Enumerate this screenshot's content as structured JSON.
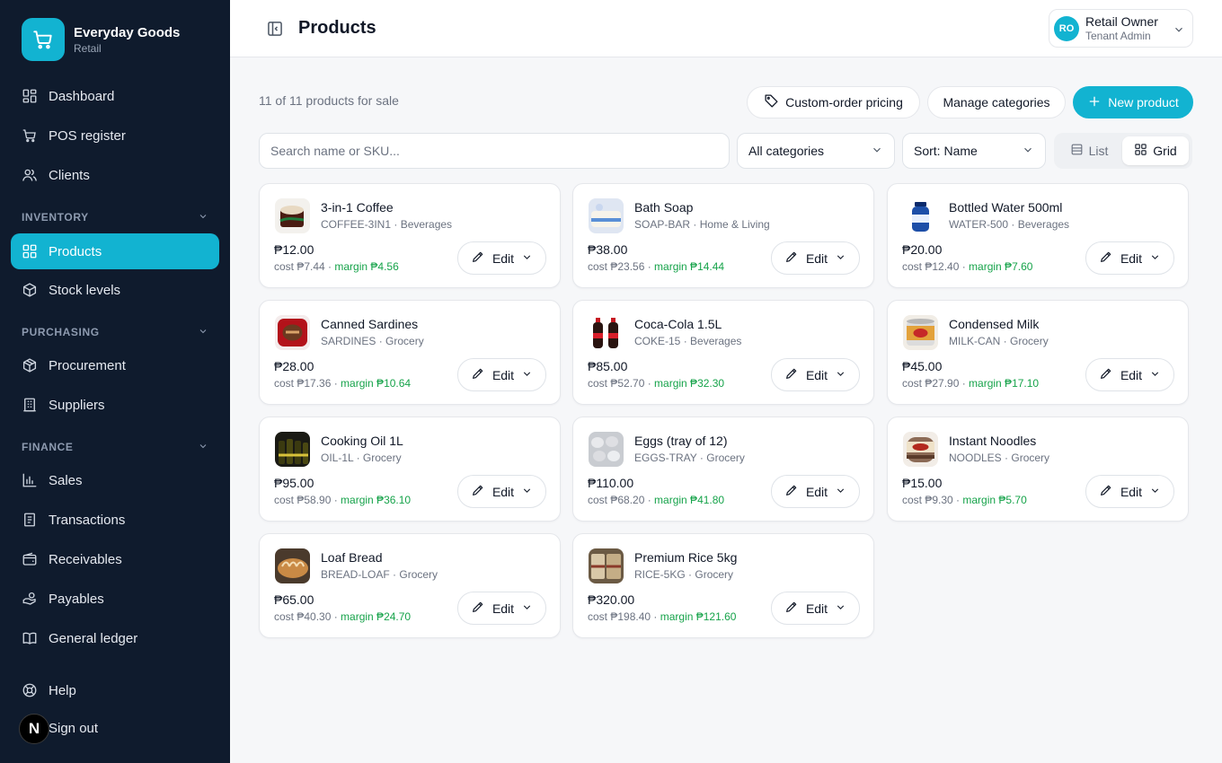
{
  "brand": {
    "name": "Everyday Goods",
    "sub": "Retail",
    "icon": "cart-icon"
  },
  "nav": {
    "dashboard": "Dashboard",
    "pos": "POS register",
    "clients": "Clients",
    "inventory_section": "INVENTORY",
    "products": "Products",
    "stock": "Stock levels",
    "purchasing_section": "PURCHASING",
    "procurement": "Procurement",
    "suppliers": "Suppliers",
    "finance_section": "FINANCE",
    "sales": "Sales",
    "transactions": "Transactions",
    "receivables": "Receivables",
    "payables": "Payables",
    "ledger": "General ledger",
    "help": "Help",
    "signout": "Sign out"
  },
  "badge": {
    "letter": "N"
  },
  "header": {
    "title": "Products",
    "user": {
      "initials": "RO",
      "name": "Retail Owner",
      "role": "Tenant Admin"
    }
  },
  "toolbar": {
    "count_text": "11 of 11 products for sale",
    "custom_pricing": "Custom-order pricing",
    "manage_categories": "Manage categories",
    "new_product": "New product",
    "search_placeholder": "Search name or SKU...",
    "category_select": "All categories",
    "sort_select": "Sort: Name",
    "view_list": "List",
    "view_grid": "Grid"
  },
  "colors": {
    "accent": "#12b3d1",
    "sidebar": "#0f1b2d",
    "margin": "#16a34a"
  },
  "products": [
    {
      "name": "3-in-1 Coffee",
      "sku": "COFFEE-3IN1",
      "category": "Beverages",
      "price": "₱12.00",
      "cost": "cost ₱7.44",
      "margin": "margin ₱4.56",
      "edit": "Edit"
    },
    {
      "name": "Bath Soap",
      "sku": "SOAP-BAR",
      "category": "Home & Living",
      "price": "₱38.00",
      "cost": "cost ₱23.56",
      "margin": "margin ₱14.44",
      "edit": "Edit"
    },
    {
      "name": "Bottled Water 500ml",
      "sku": "WATER-500",
      "category": "Beverages",
      "price": "₱20.00",
      "cost": "cost ₱12.40",
      "margin": "margin ₱7.60",
      "edit": "Edit"
    },
    {
      "name": "Canned Sardines",
      "sku": "SARDINES",
      "category": "Grocery",
      "price": "₱28.00",
      "cost": "cost ₱17.36",
      "margin": "margin ₱10.64",
      "edit": "Edit"
    },
    {
      "name": "Coca-Cola 1.5L",
      "sku": "COKE-15",
      "category": "Beverages",
      "price": "₱85.00",
      "cost": "cost ₱52.70",
      "margin": "margin ₱32.30",
      "edit": "Edit"
    },
    {
      "name": "Condensed Milk",
      "sku": "MILK-CAN",
      "category": "Grocery",
      "price": "₱45.00",
      "cost": "cost ₱27.90",
      "margin": "margin ₱17.10",
      "edit": "Edit"
    },
    {
      "name": "Cooking Oil 1L",
      "sku": "OIL-1L",
      "category": "Grocery",
      "price": "₱95.00",
      "cost": "cost ₱58.90",
      "margin": "margin ₱36.10",
      "edit": "Edit"
    },
    {
      "name": "Eggs (tray of 12)",
      "sku": "EGGS-TRAY",
      "category": "Grocery",
      "price": "₱110.00",
      "cost": "cost ₱68.20",
      "margin": "margin ₱41.80",
      "edit": "Edit"
    },
    {
      "name": "Instant Noodles",
      "sku": "NOODLES",
      "category": "Grocery",
      "price": "₱15.00",
      "cost": "cost ₱9.30",
      "margin": "margin ₱5.70",
      "edit": "Edit"
    },
    {
      "name": "Loaf Bread",
      "sku": "BREAD-LOAF",
      "category": "Grocery",
      "price": "₱65.00",
      "cost": "cost ₱40.30",
      "margin": "margin ₱24.70",
      "edit": "Edit"
    },
    {
      "name": "Premium Rice 5kg",
      "sku": "RICE-5KG",
      "category": "Grocery",
      "price": "₱320.00",
      "cost": "cost ₱198.40",
      "margin": "margin ₱121.60",
      "edit": "Edit"
    }
  ]
}
